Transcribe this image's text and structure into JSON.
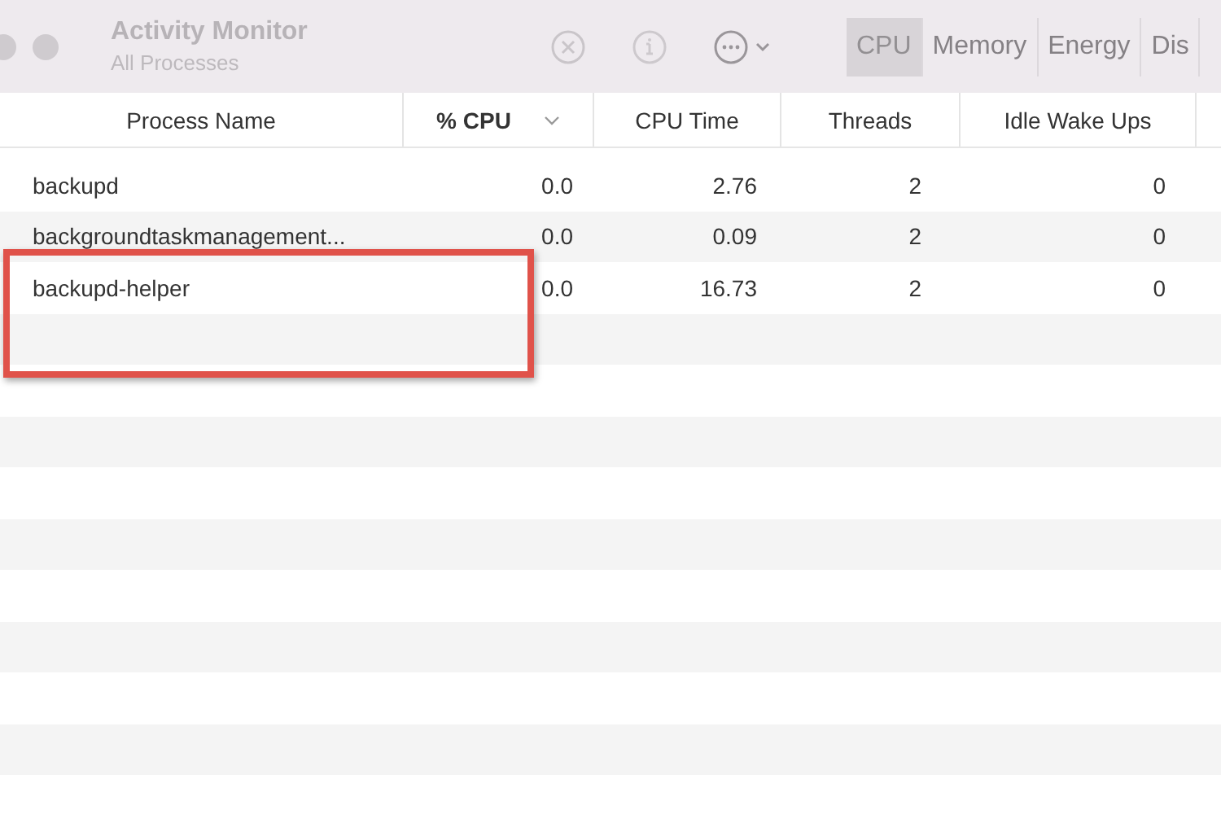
{
  "window": {
    "title": "Activity Monitor",
    "subtitle": "All Processes"
  },
  "tabs": [
    {
      "label": "CPU",
      "selected": true
    },
    {
      "label": "Memory",
      "selected": false
    },
    {
      "label": "Energy",
      "selected": false
    },
    {
      "label": "Dis",
      "selected": false
    }
  ],
  "table": {
    "columns": [
      {
        "label": "Process Name",
        "sorted": false
      },
      {
        "label": "% CPU",
        "sorted": true
      },
      {
        "label": "CPU Time",
        "sorted": false
      },
      {
        "label": "Threads",
        "sorted": false
      },
      {
        "label": "Idle Wake Ups",
        "sorted": false
      }
    ],
    "rows": [
      [
        "backupd",
        "0.0",
        "2.76",
        "2",
        "0"
      ],
      [
        "backgroundtaskmanagement...",
        "0.0",
        "0.09",
        "2",
        "0"
      ],
      [
        "backupd-helper",
        "0.0",
        "16.73",
        "2",
        "0"
      ]
    ]
  }
}
